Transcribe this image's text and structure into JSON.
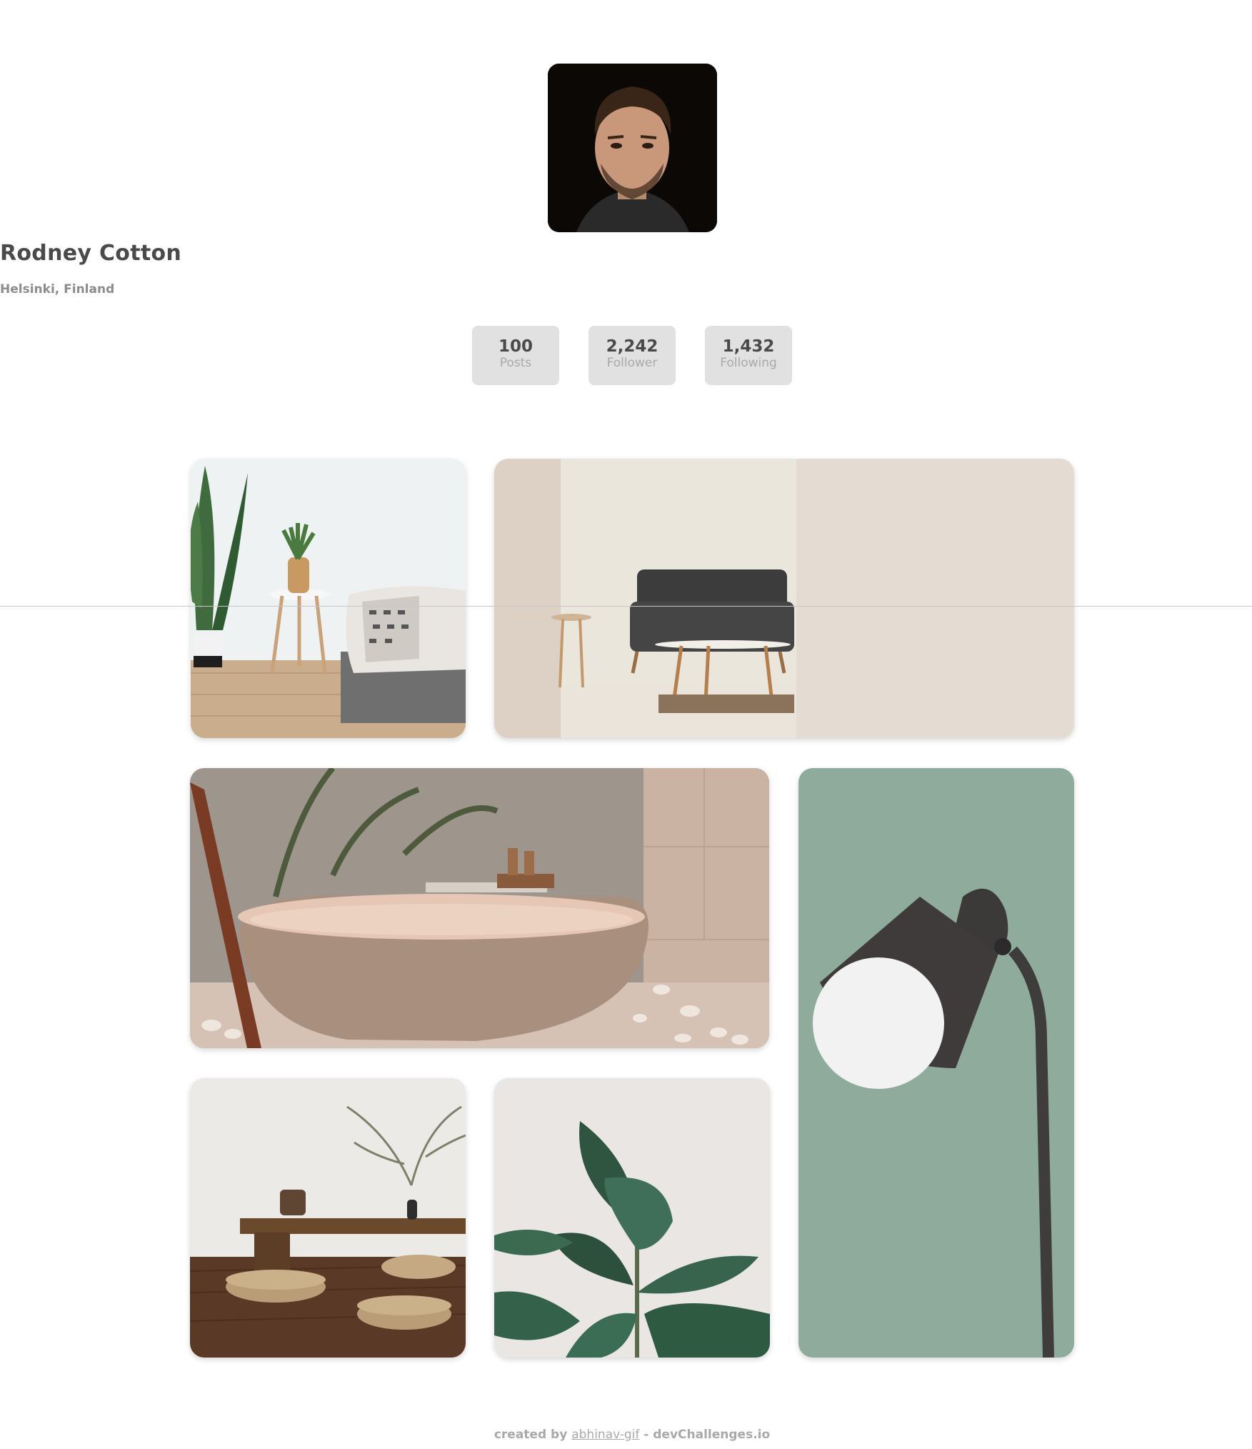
{
  "profile": {
    "name": "Rodney Cotton",
    "location": "Helsinki, Finland",
    "avatar_alt": "portrait-photo"
  },
  "stats": [
    {
      "value": "100",
      "label": "Posts"
    },
    {
      "value": "2,242",
      "label": "Follower"
    },
    {
      "value": "1,432",
      "label": "Following"
    }
  ],
  "gallery": [
    {
      "name": "bedroom-plant-photo"
    },
    {
      "name": "living-room-sofa-photo"
    },
    {
      "name": "bathtub-photo"
    },
    {
      "name": "floor-lamp-photo"
    },
    {
      "name": "low-table-cushions-photo"
    },
    {
      "name": "rubber-plant-photo"
    }
  ],
  "footer": {
    "prefix": "created by",
    "author": "abhinav-gif",
    "separator": "-",
    "site": "devChallenges.io"
  }
}
